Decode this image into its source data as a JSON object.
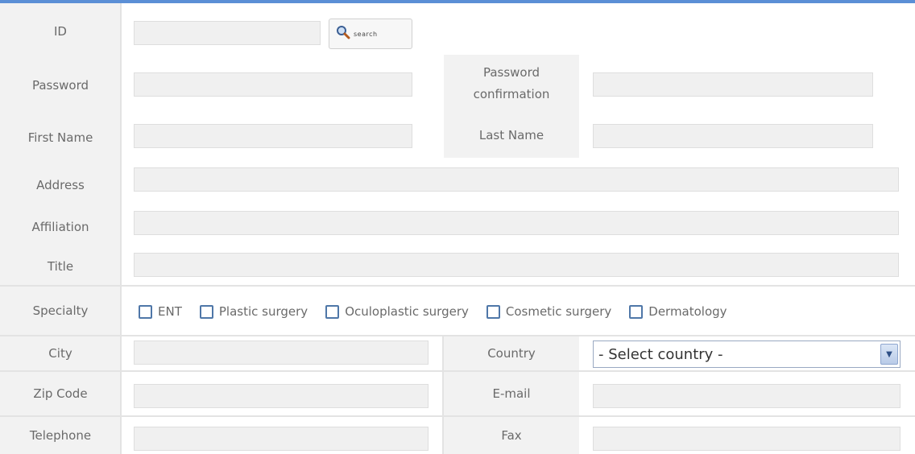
{
  "form": {
    "id_label": "ID",
    "search_button_label": "search",
    "password_label": "Password",
    "password_confirmation_label": "Password confirmation",
    "first_name_label": "First Name",
    "last_name_label": "Last Name",
    "address_label": "Address",
    "affiliation_label": "Affiliation",
    "title_label": "Title",
    "specialty_label": "Specialty",
    "specialties": [
      "ENT",
      "Plastic surgery",
      "Oculoplastic surgery",
      "Cosmetic surgery",
      "Dermatology"
    ],
    "city_label": "City",
    "country_label": "Country",
    "country_select_value": "- Select country -",
    "zip_label": "Zip Code",
    "email_label": "E-mail",
    "telephone_label": "Telephone",
    "fax_label": "Fax"
  },
  "colors": {
    "accent": "#5b8fd6",
    "checkbox_border": "#4f77a8"
  },
  "icons": {
    "search": "magnifier-icon",
    "select_arrow": "chevron-down-icon"
  }
}
